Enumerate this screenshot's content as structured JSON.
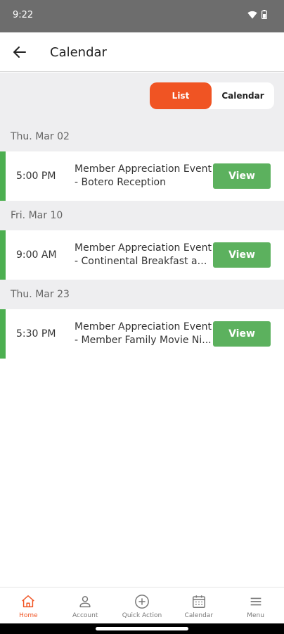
{
  "status_bar": {
    "time": "9:22"
  },
  "app_bar": {
    "title": "Calendar"
  },
  "view_toggle": {
    "list_label": "List",
    "calendar_label": "Calendar",
    "selected": "List"
  },
  "groups": [
    {
      "date": "Thu. Mar 02",
      "events": [
        {
          "time": "5:00 PM",
          "title_line1": "Member Appreciation Event",
          "title_line2": "- Botero Reception",
          "button": "View"
        }
      ]
    },
    {
      "date": "Fri. Mar 10",
      "events": [
        {
          "time": "9:00 AM",
          "title_line1": "Member Appreciation Event",
          "title_line2": "- Continental Breakfast an...",
          "button": "View"
        }
      ]
    },
    {
      "date": "Thu. Mar 23",
      "events": [
        {
          "time": "5:30 PM",
          "title_line1": "Member Appreciation Event",
          "title_line2": "- Member Family Movie Ni...",
          "button": "View"
        }
      ]
    }
  ],
  "bottom_nav": {
    "items": [
      {
        "label": "Home",
        "icon": "home-icon",
        "active": true
      },
      {
        "label": "Account",
        "icon": "person-icon",
        "active": false
      },
      {
        "label": "Quick Action",
        "icon": "plus-circle-icon",
        "active": false
      },
      {
        "label": "Calendar",
        "icon": "calendar-icon",
        "active": false
      },
      {
        "label": "Menu",
        "icon": "hamburger-icon",
        "active": false
      }
    ]
  },
  "colors": {
    "accent": "#f05423",
    "event_green": "#5cb15e",
    "event_bar": "#4caf50",
    "status_bar": "#6d6d6d"
  }
}
